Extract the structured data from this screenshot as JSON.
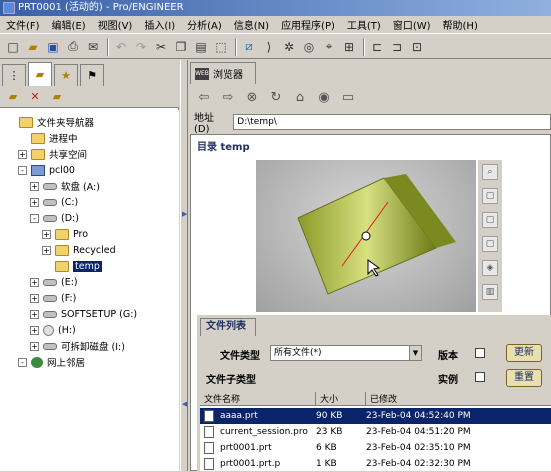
{
  "window": {
    "title": "PRT0001 (活动的) - Pro/ENGINEER"
  },
  "menu": [
    "文件(F)",
    "编辑(E)",
    "视图(V)",
    "插入(I)",
    "分析(A)",
    "信息(N)",
    "应用程序(P)",
    "工具(T)",
    "窗口(W)",
    "帮助(H)"
  ],
  "toolbar": {
    "icons": [
      "new-icon",
      "open-icon",
      "save-icon",
      "print-icon",
      "email-icon",
      "undo-icon",
      "redo-icon",
      "cut-icon",
      "copy-icon",
      "paste-icon",
      "select-box-icon",
      "sketch-icon",
      "datum-icon",
      "spin-icon",
      "zoom-icon",
      "orient-icon",
      "view-icon",
      "datum-plane-icon",
      "axis-icon",
      "csys-icon"
    ]
  },
  "sidebar": {
    "tabs": [
      "model-tree-icon",
      "folder-browser-icon",
      "favorites-icon",
      "connections-icon"
    ],
    "buttons": [
      "new-folder-icon",
      "delete-icon",
      "add-icon"
    ],
    "tree": [
      {
        "label": "文件夹导航器",
        "level": 0,
        "icon": "folder",
        "expander": ""
      },
      {
        "label": "进程中",
        "level": 1,
        "icon": "folder",
        "expander": ""
      },
      {
        "label": "共享空间",
        "level": 1,
        "icon": "folder",
        "expander": "+"
      },
      {
        "label": "pcl00",
        "level": 1,
        "icon": "pc",
        "expander": "-"
      },
      {
        "label": "软盘 (A:)",
        "level": 2,
        "icon": "drive",
        "expander": "+"
      },
      {
        "label": "(C:)",
        "level": 2,
        "icon": "drive",
        "expander": "+"
      },
      {
        "label": "(D:)",
        "level": 2,
        "icon": "drive",
        "expander": "-"
      },
      {
        "label": "Pro",
        "level": 3,
        "icon": "folder",
        "expander": "+"
      },
      {
        "label": "Recycled",
        "level": 3,
        "icon": "folder",
        "expander": "+"
      },
      {
        "label": "temp",
        "level": 3,
        "icon": "folder",
        "expander": "",
        "selected": true
      },
      {
        "label": "(E:)",
        "level": 2,
        "icon": "drive",
        "expander": "+"
      },
      {
        "label": "(F:)",
        "level": 2,
        "icon": "drive",
        "expander": "+"
      },
      {
        "label": "SOFTSETUP (G:)",
        "level": 2,
        "icon": "drive",
        "expander": "+"
      },
      {
        "label": "(H:)",
        "level": 2,
        "icon": "cd",
        "expander": "+"
      },
      {
        "label": "可拆卸磁盘 (I:)",
        "level": 2,
        "icon": "drive",
        "expander": "+"
      },
      {
        "label": "网上邻居",
        "level": 1,
        "icon": "net",
        "expander": "-"
      }
    ]
  },
  "browser": {
    "tab_label": "浏览器",
    "tab_icon_text": "WEB",
    "nav": [
      "back-icon",
      "forward-icon",
      "stop-icon",
      "refresh-icon",
      "home-icon",
      "history-icon",
      "print-icon"
    ],
    "address_label": "地址(D)",
    "address_value": "D:\\temp\\",
    "directory_title": "目录 temp",
    "file_panel": {
      "tab": "文件列表",
      "type_label": "文件类型",
      "type_value": "所有文件(*)",
      "version_label": "版本",
      "instance_label": "实例",
      "subtype_label": "文件子类型",
      "update_button": "更新",
      "reset_button": "重置",
      "columns": [
        "文件名称",
        "大小",
        "已修改"
      ],
      "rows": [
        {
          "name": "aaaa.prt",
          "size": "90 KB",
          "modified": "23-Feb-04 04:52:40 PM",
          "selected": true
        },
        {
          "name": "current_session.pro",
          "size": "23 KB",
          "modified": "23-Feb-04 04:51:20 PM"
        },
        {
          "name": "prt0001.prt",
          "size": "6 KB",
          "modified": "23-Feb-04 02:35:10 PM"
        },
        {
          "name": "prt0001.prt.p",
          "size": "1 KB",
          "modified": "23-Feb-04 02:32:30 PM"
        }
      ]
    },
    "viewer_tools": [
      "zoom-fit-icon",
      "front-view-icon",
      "top-view-icon",
      "side-view-icon",
      "iso-view-icon",
      "shade-icon"
    ]
  },
  "colors": {
    "titlebar": "#3a5fa8",
    "selection": "#0a246a",
    "model": "#b8c040"
  }
}
